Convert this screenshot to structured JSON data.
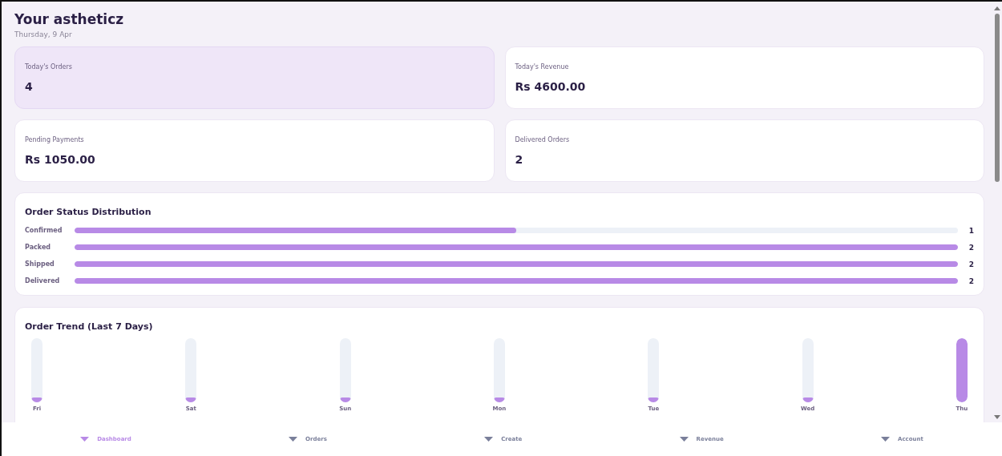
{
  "header": {
    "title": "Your astheticz",
    "date": "Thursday, 9 Apr"
  },
  "stats": [
    {
      "label": "Today's Orders",
      "value": "4",
      "selected": true
    },
    {
      "label": "Today's Revenue",
      "value": "Rs 4600.00",
      "selected": false
    },
    {
      "label": "Pending Payments",
      "value": "Rs 1050.00",
      "selected": false
    },
    {
      "label": "Delivered Orders",
      "value": "2",
      "selected": false
    }
  ],
  "status_distribution": {
    "title": "Order Status Distribution",
    "rows": [
      {
        "label": "Confirmed",
        "level": 0.5,
        "count": "1"
      },
      {
        "label": "Packed",
        "level": 1,
        "count": "2"
      },
      {
        "label": "Shipped",
        "level": 1,
        "count": "2"
      },
      {
        "label": "Delivered",
        "level": 1,
        "count": "2"
      }
    ]
  },
  "order_trend": {
    "title": "Order Trend (Last 7 Days)",
    "days": [
      {
        "label": "Fri",
        "level": 0.08
      },
      {
        "label": "Sat",
        "level": 0.08
      },
      {
        "label": "Sun",
        "level": 0.08
      },
      {
        "label": "Mon",
        "level": 0.08
      },
      {
        "label": "Tue",
        "level": 0.08
      },
      {
        "label": "Wed",
        "level": 0.08
      },
      {
        "label": "Thu",
        "level": 1
      }
    ]
  },
  "nav": [
    {
      "label": "Dashboard",
      "selected": true
    },
    {
      "label": "Orders",
      "selected": false
    },
    {
      "label": "Create",
      "selected": false
    },
    {
      "label": "Revenue",
      "selected": false
    },
    {
      "label": "Account",
      "selected": false
    }
  ]
}
